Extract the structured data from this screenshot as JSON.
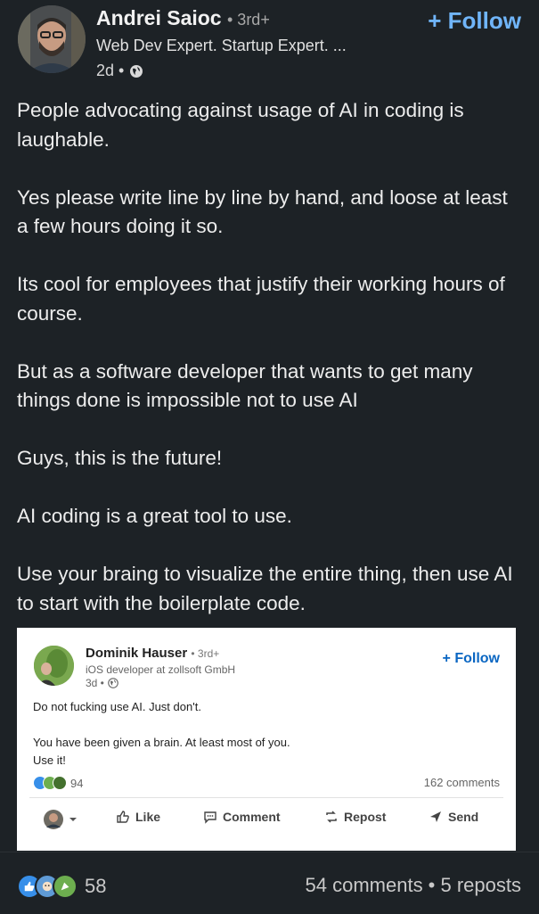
{
  "post": {
    "author": {
      "name": "Andrei Saioc",
      "degree": "• 3rd+",
      "headline": "Web Dev Expert. Startup Expert. ...",
      "time": "2d •"
    },
    "follow_label": "+ Follow",
    "paragraphs": [
      "People advocating against usage of AI in coding is laughable.",
      "Yes please write line by line by hand, and loose at least a few hours doing it so.",
      "Its cool for employees that justify their working hours of course.",
      "But as a software developer that wants to get many things done is impossible not to use AI",
      "Guys, this is the future!",
      "AI coding is a great tool to use.",
      "Use your braing to visualize the entire thing, then use AI to start with the boilerplate code."
    ],
    "reaction_count": "58",
    "stats": "54 comments • 5 reposts",
    "reaction_icons": [
      "like-icon",
      "support-icon",
      "celebrate-icon"
    ],
    "colors": {
      "background": "#1d2226",
      "follow": "#70b5f9",
      "text": "#ededed"
    }
  },
  "embedded": {
    "author": {
      "name": "Dominik Hauser",
      "degree": "• 3rd+",
      "headline": "iOS developer at zollsoft GmbH",
      "time": "3d •"
    },
    "follow_label": "+ Follow",
    "paragraphs": [
      "Do not fucking use AI. Just don't.",
      "You have been given a brain. At least most of you.\nUse it!"
    ],
    "reaction_count": "94",
    "comments": "162 comments",
    "actions": {
      "like": "Like",
      "comment": "Comment",
      "repost": "Repost",
      "send": "Send"
    },
    "colors": {
      "follow": "#0a66c2"
    }
  }
}
